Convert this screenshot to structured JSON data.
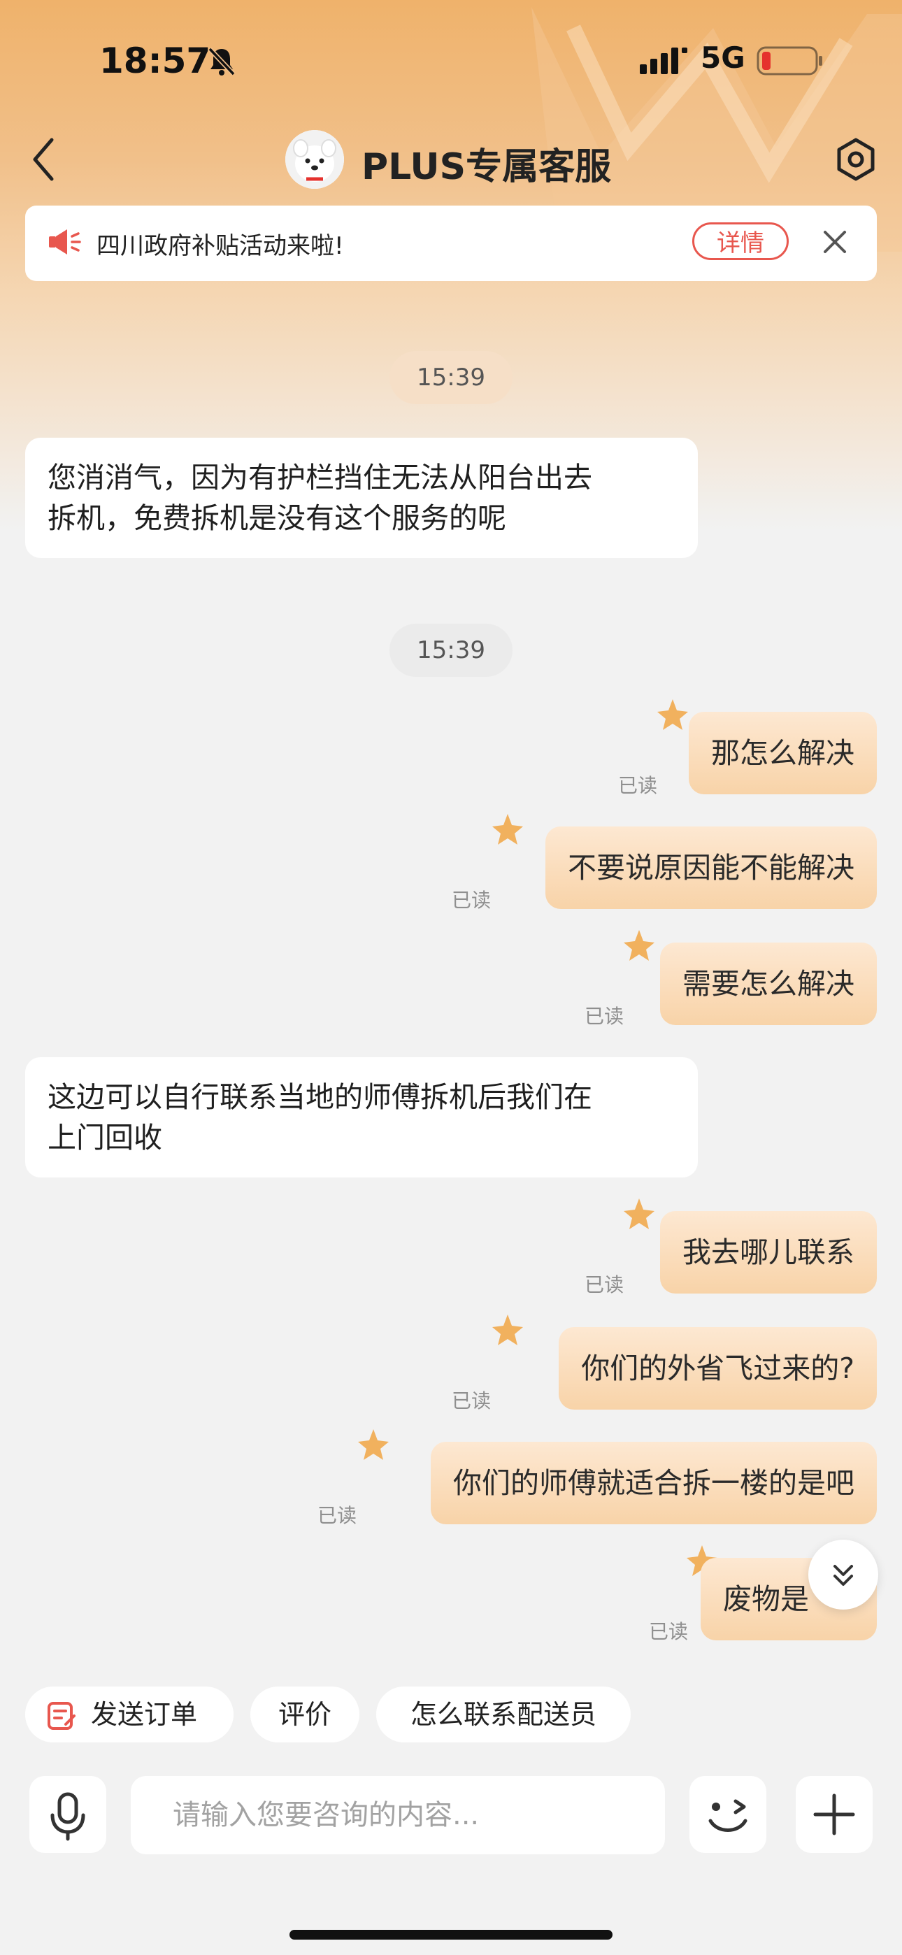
{
  "status_bar": {
    "time": "18:57",
    "network": "5G"
  },
  "header": {
    "title": "PLUS专属客服"
  },
  "notice": {
    "text": "四川政府补贴活动来啦!",
    "detail_label": "详情"
  },
  "messages": [
    {
      "type": "timestamp",
      "text": "15:39"
    },
    {
      "type": "incoming",
      "lines": [
        "您消消气，因为有护栏挡住无法从阳台出去",
        "拆机，免费拆机是没有这个服务的呢"
      ]
    },
    {
      "type": "timestamp",
      "text": "15:39"
    },
    {
      "type": "outgoing",
      "text": "那怎么解决",
      "status": "已读"
    },
    {
      "type": "outgoing",
      "text": "不要说原因能不能解决",
      "status": "已读"
    },
    {
      "type": "outgoing",
      "text": "需要怎么解决",
      "status": "已读"
    },
    {
      "type": "incoming",
      "lines": [
        "这边可以自行联系当地的师傅拆机后我们在",
        "上门回收"
      ]
    },
    {
      "type": "outgoing",
      "text": "我去哪儿联系",
      "status": "已读"
    },
    {
      "type": "outgoing",
      "text": "你们的外省飞过来的?",
      "status": "已读"
    },
    {
      "type": "outgoing",
      "text": "你们的师傅就适合拆一楼的是吧",
      "status": "已读"
    },
    {
      "type": "outgoing",
      "text": "废物是",
      "status": "已读"
    }
  ],
  "quick_actions": [
    "发送订单",
    "评价",
    "怎么联系配送员"
  ],
  "input": {
    "placeholder": "请输入您要咨询的内容..."
  },
  "colors": {
    "accent_red": "#e8574e",
    "bubble_out": "#f8d3a8",
    "header_gradient": "#efb26b"
  },
  "icons": [
    "bell-muted-icon",
    "signal-icon",
    "battery-icon",
    "back-icon",
    "mascot-avatar",
    "settings-icon",
    "speaker-icon",
    "close-icon",
    "star-icon",
    "chevron-double-down-icon",
    "order-icon",
    "microphone-icon",
    "emoji-icon",
    "plus-icon"
  ]
}
